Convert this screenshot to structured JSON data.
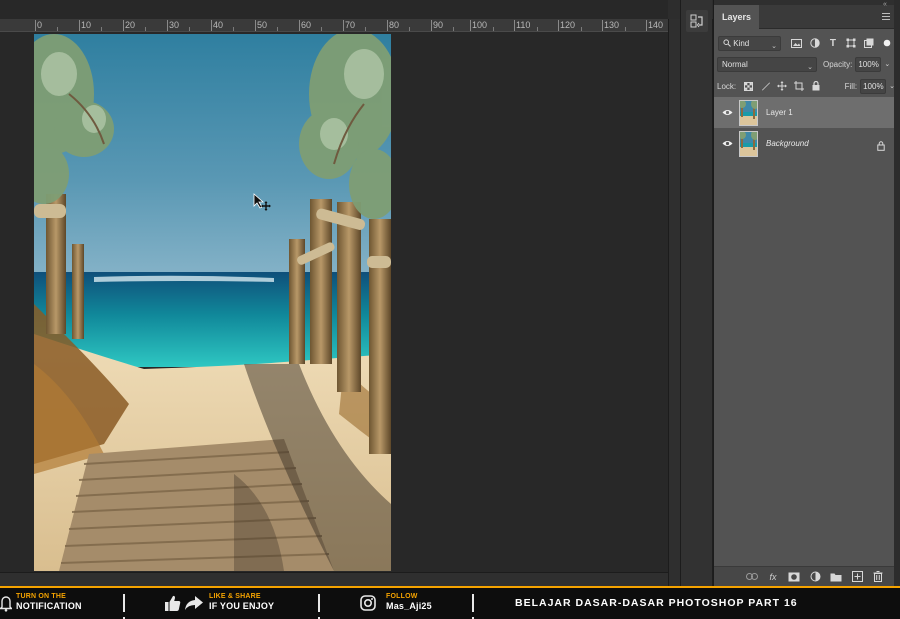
{
  "ruler": {
    "ticks": [
      "0",
      "10",
      "20",
      "30",
      "40",
      "50",
      "60",
      "70",
      "80",
      "90",
      "100",
      "110",
      "120",
      "130",
      "140"
    ]
  },
  "layers_panel": {
    "tab_label": "Layers",
    "filter": {
      "kind_label": "Kind"
    },
    "blend_mode": "Normal",
    "opacity_label": "Opacity:",
    "opacity_value": "100%",
    "lock_label": "Lock:",
    "fill_label": "Fill:",
    "fill_value": "100%",
    "layers": [
      {
        "name": "Layer 1",
        "selected": true,
        "visible": true
      },
      {
        "name": "Background",
        "selected": false,
        "visible": true,
        "locked": true
      }
    ],
    "footer_icons": [
      "link-icon",
      "fx-icon",
      "mask-icon",
      "adjustment-icon",
      "folder-icon",
      "new-layer-icon",
      "trash-icon"
    ],
    "footer_fx_label": "fx"
  },
  "banner": {
    "notify_small": "TURN ON THE",
    "notify_big": "NOTIFICATION",
    "like_small": "LIKE & SHARE",
    "like_big": "IF YOU ENJOY",
    "follow_small": "FOLLOW",
    "follow_big": "Mas_Aji25",
    "title": "BELAJAR DASAR-DASAR PHOTOSHOP PART 16",
    "accent_color": "#f5a300"
  }
}
